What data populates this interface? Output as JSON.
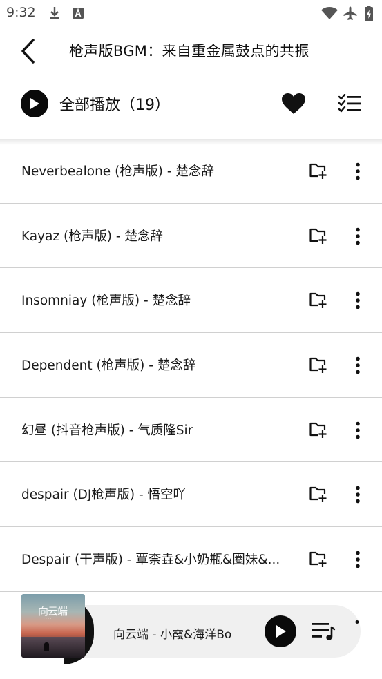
{
  "status_bar": {
    "time": "9:32",
    "left_icons": [
      "download-icon",
      "font-a-icon"
    ],
    "right_icons": [
      "wifi-icon",
      "airplane-icon",
      "battery-icon"
    ]
  },
  "header": {
    "back_icon": "back-arrow-icon",
    "title": "枪声版BGM：来自重金属鼓点的共振"
  },
  "actions": {
    "play_all_label": "全部播放（19）",
    "favorite_icon": "heart-icon",
    "multiselect_icon": "checklist-icon"
  },
  "songs": [
    {
      "title": "Neverbealone (枪声版) - 楚念辞"
    },
    {
      "title": "Kayaz (枪声版) - 楚念辞"
    },
    {
      "title": "Insomniay (枪声版) - 楚念辞"
    },
    {
      "title": "Dependent (枪声版) - 楚念辞"
    },
    {
      "title": "幻昼 (抖音枪声版) - 气质隆Sir"
    },
    {
      "title": "despair (DJ枪声版) - 悟空吖"
    },
    {
      "title": "Despair (干声版) - 覃柰垚&小奶瓶&圈妹&..."
    }
  ],
  "mini_player": {
    "now_playing": "向云端 - 小霞&海洋Bo",
    "cover_title": "向云端"
  },
  "colors": {
    "accent": "#0a0a0a",
    "divider": "#d0d0d0",
    "player_bg": "#f0f0f0"
  }
}
